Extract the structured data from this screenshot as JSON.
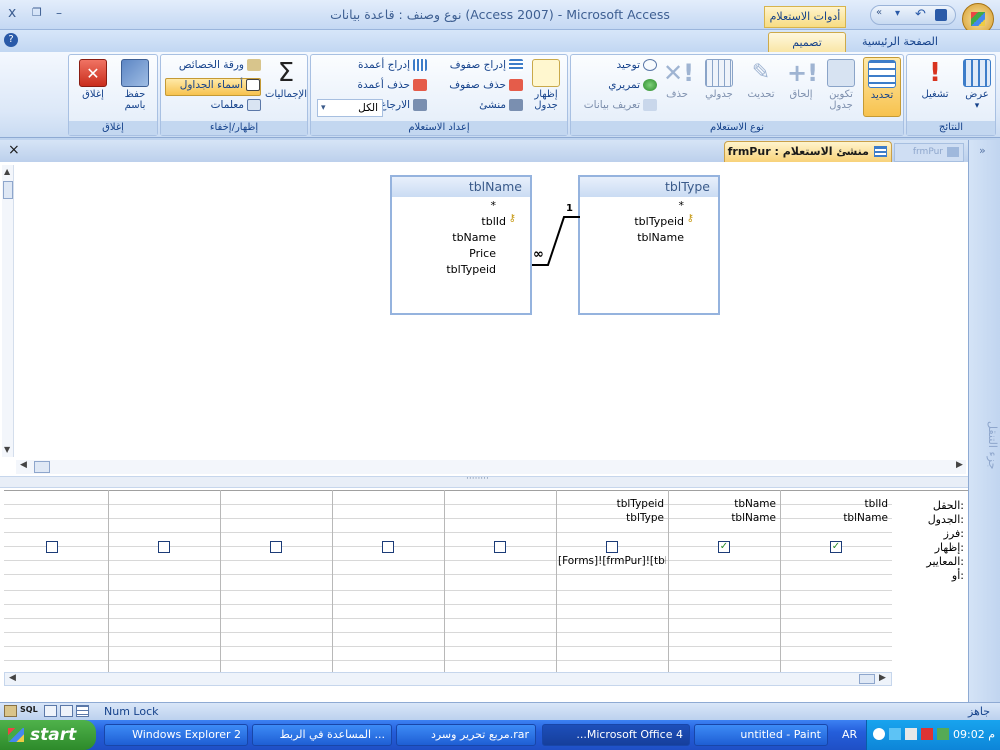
{
  "titlebar": {
    "title": "نوع وصنف : قاعدة بيانات (Access 2007) - Microsoft Access",
    "context_tools": "أدوات الاستعلام",
    "win_close": "x",
    "win_restore": "❐",
    "win_min": "–"
  },
  "ribbon_tabs": {
    "home": "الصفحة الرئيسية",
    "design": "تصميم"
  },
  "groups": {
    "results": {
      "label": "النتائج",
      "view": "عرض",
      "run": "تشغيل"
    },
    "query_type": {
      "label": "نوع الاستعلام",
      "select": "تحديد",
      "make_table": "تكوين جدول",
      "append": "إلحاق",
      "update": "تحديث",
      "crosstab": "جدولي",
      "delete": "حذف",
      "union": "توحيد",
      "pass_through": "تمريري",
      "data_def": "تعريف بيانات"
    },
    "setup": {
      "label": "إعداد الاستعلام",
      "show_table": "إظهار جدول",
      "insert_rows": "إدراج صفوف",
      "delete_rows": "حذف صفوف",
      "builder": "منشئ",
      "insert_cols": "إدراج أعمدة",
      "delete_cols": "حذف أعمدة",
      "return": "الارجاع:",
      "return_value": "الكل"
    },
    "show_hide": {
      "label": "إظهار/إخفاء",
      "totals": "الإجماليات",
      "property_sheet": "ورقة الخصائص",
      "table_names": "أسماء الجداول",
      "parameters": "معلمات"
    },
    "close": {
      "label": "إغلاق",
      "save_as": "حفظ باسم",
      "close": "إغلاق"
    }
  },
  "object_tab": {
    "active": "frmPur : منشئ الاستعلام",
    "inactive": "frmPur",
    "close": "×"
  },
  "nav_pane_label": "جزء التنقل",
  "tables": [
    {
      "name": "tblName",
      "star": "*",
      "fields": [
        "tblId",
        "tbName",
        "Price",
        "tblTypeid"
      ]
    },
    {
      "name": "tblType",
      "star": "*",
      "fields": [
        "tblTypeid",
        "tblName"
      ]
    }
  ],
  "relation": {
    "one": "1",
    "many": "∞"
  },
  "grid": {
    "row_labels": [
      "الحقل:",
      "الجدول:",
      "فرز:",
      "إظهار:",
      "المعايير:",
      "أو:"
    ],
    "columns": [
      {
        "field": "tblId",
        "table": "tblName",
        "show": true,
        "criteria": ""
      },
      {
        "field": "tbName",
        "table": "tblName",
        "show": true,
        "criteria": ""
      },
      {
        "field": "tblTypeid",
        "table": "tblType",
        "show": false,
        "criteria": "[Forms]![frmPur]![tblTy"
      },
      {
        "field": "",
        "table": "",
        "show": false,
        "criteria": ""
      },
      {
        "field": "",
        "table": "",
        "show": false,
        "criteria": ""
      },
      {
        "field": "",
        "table": "",
        "show": false,
        "criteria": ""
      },
      {
        "field": "",
        "table": "",
        "show": false,
        "criteria": ""
      },
      {
        "field": "",
        "table": "",
        "show": false,
        "criteria": ""
      }
    ]
  },
  "status": {
    "ready": "جاهز",
    "numlock": "Num Lock",
    "sql": "SQL"
  },
  "taskbar": {
    "start": "start",
    "items": [
      "2 Windows Explorer",
      "... المساعدة في الربط",
      "rar.مربع تحرير وسرد",
      "4 Microsoft Office...",
      "untitled - Paint"
    ],
    "lang": "AR",
    "clock": "09:02 م"
  },
  "colors": {
    "accent": "#f7c14a",
    "ribbon": "#dce8f8",
    "taskbar": "#245edb"
  }
}
